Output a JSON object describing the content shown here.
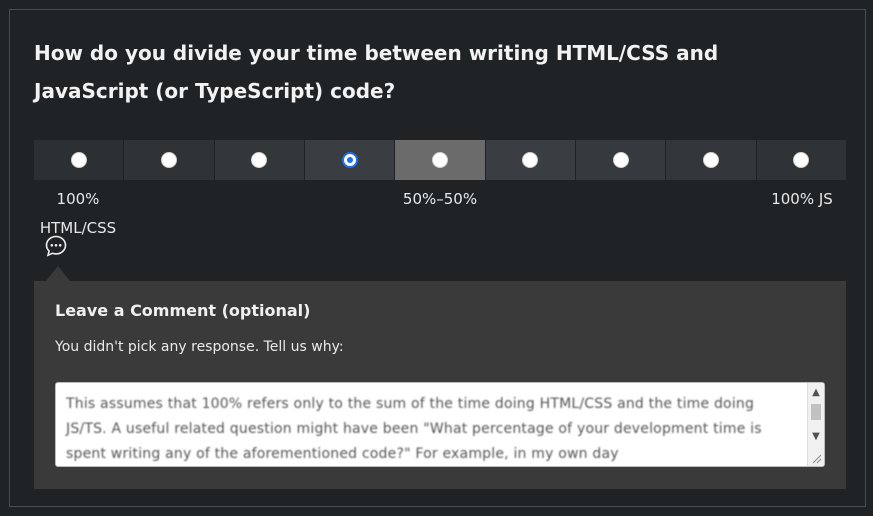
{
  "question": {
    "text": "How do you divide your time between writing HTML/CSS and JavaScript (or TypeScript) code?"
  },
  "scale": {
    "options": [
      {
        "id": "opt1",
        "selected": false,
        "bg": "#2d3033"
      },
      {
        "id": "opt2",
        "selected": false,
        "bg": "#303336"
      },
      {
        "id": "opt3",
        "selected": false,
        "bg": "#33373a"
      },
      {
        "id": "opt4",
        "selected": true,
        "bg": "#3a3d41"
      },
      {
        "id": "opt5",
        "selected": false,
        "bg": "#6b6b6b"
      },
      {
        "id": "opt6",
        "selected": false,
        "bg": "#3a3d41"
      },
      {
        "id": "opt7",
        "selected": false,
        "bg": "#36393d"
      },
      {
        "id": "opt8",
        "selected": false,
        "bg": "#33363a"
      },
      {
        "id": "opt9",
        "selected": false,
        "bg": "#303336"
      }
    ],
    "label_left_line1": "100%",
    "label_left_line2": "HTML/CSS",
    "label_middle": "50%–50%",
    "label_right": "100% JS"
  },
  "comment": {
    "icon": "speech-bubble-icon",
    "title": "Leave a Comment (optional)",
    "prompt": "You didn't pick any response. Tell us why:",
    "value": "This assumes that 100% refers only to the sum of the time doing HTML/CSS and the time doing JS/TS. A useful related question might have been \"What percentage of your development time is spent writing any of the aforementioned code?\" For example, in my own day"
  },
  "colors": {
    "background": "#202326",
    "accent": "#1f6fe8",
    "panel": "#3a3a3a"
  }
}
